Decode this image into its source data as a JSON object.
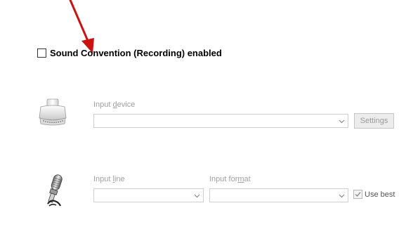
{
  "sound_convention": {
    "label": "Sound Convention (Recording) enabled",
    "checked": false
  },
  "input_device": {
    "label_before": "Input ",
    "label_accel": "d",
    "label_after": "evice",
    "value": "",
    "settings_label": "Settings",
    "icon": "usb-connector-icon"
  },
  "input_line": {
    "label_before": "Input ",
    "label_accel": "l",
    "label_after": "ine",
    "value": "",
    "icon": "microphone-icon"
  },
  "input_format": {
    "label_before": "Input for",
    "label_accel": "m",
    "label_after": "at",
    "value": ""
  },
  "use_best": {
    "label": "Use best",
    "checked": true
  },
  "colors": {
    "annotation": "#cc1111",
    "disabled_text": "#a0a0a0"
  }
}
